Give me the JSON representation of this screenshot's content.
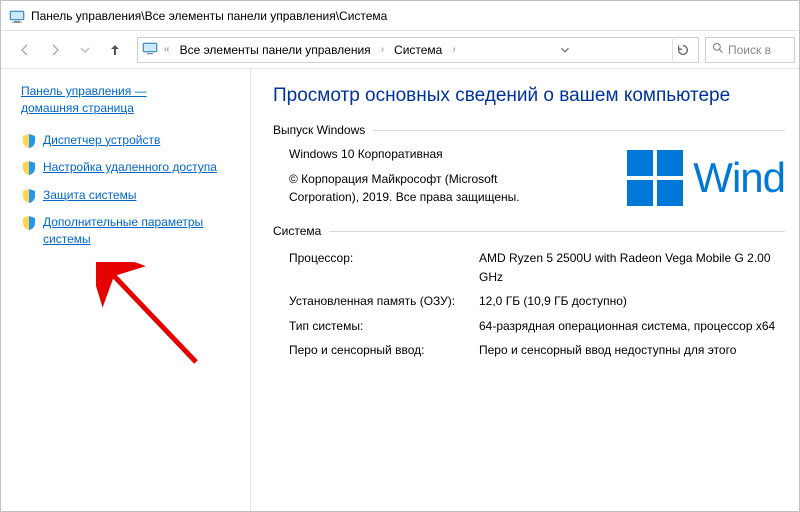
{
  "titlebar": {
    "path": "Панель управления\\Все элементы панели управления\\Система"
  },
  "breadcrumb": {
    "prefix": "«",
    "item1": "Все элементы панели управления",
    "item2": "Система"
  },
  "search": {
    "placeholder": "Поиск в"
  },
  "sidebar": {
    "home_line1": "Панель управления —",
    "home_line2": "домашняя страница",
    "items": [
      {
        "label": "Диспетчер устройств"
      },
      {
        "label": "Настройка удаленного доступа"
      },
      {
        "label": "Защита системы"
      },
      {
        "label": "Дополнительные параметры системы"
      }
    ]
  },
  "content": {
    "heading": "Просмотр основных сведений о вашем компьютере",
    "windows_group": {
      "title": "Выпуск Windows",
      "edition": "Windows 10 Корпоративная",
      "copyright": "© Корпорация Майкрософт (Microsoft Corporation), 2019. Все права защищены.",
      "logo_word": "Wind"
    },
    "system_group": {
      "title": "Система",
      "rows": [
        {
          "key": "Процессор:",
          "val": "AMD Ryzen 5 2500U with Radeon Vega Mobile G   2.00 GHz"
        },
        {
          "key": "Установленная память (ОЗУ):",
          "val": "12,0 ГБ (10,9 ГБ доступно)"
        },
        {
          "key": "Тип системы:",
          "val": "64-разрядная операционная система, процессор x64"
        },
        {
          "key": "Перо и сенсорный ввод:",
          "val": "Перо и сенсорный ввод недоступны для этого"
        }
      ]
    }
  }
}
